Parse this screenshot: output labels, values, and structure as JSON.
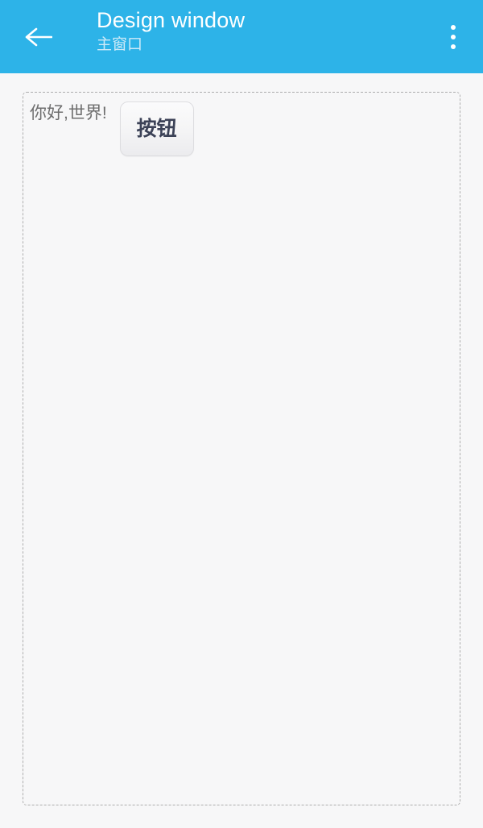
{
  "appbar": {
    "back_icon": "arrow-left-icon",
    "title": "Design window",
    "subtitle": "主窗口",
    "overflow_icon": "more-vertical-icon",
    "background_color": "#2db3e8",
    "title_color": "#ffffff",
    "subtitle_color": "#cdeaf8"
  },
  "canvas": {
    "background_color": "#f7f7f8",
    "border_style": "dashed",
    "border_color": "#adadad",
    "widgets": [
      {
        "type": "label",
        "name": "label-hello",
        "text": "你好,世界!",
        "color": "#6e6e6e"
      },
      {
        "type": "button",
        "name": "button-anniu",
        "text": "按钮",
        "color": "#3c4257"
      }
    ]
  }
}
